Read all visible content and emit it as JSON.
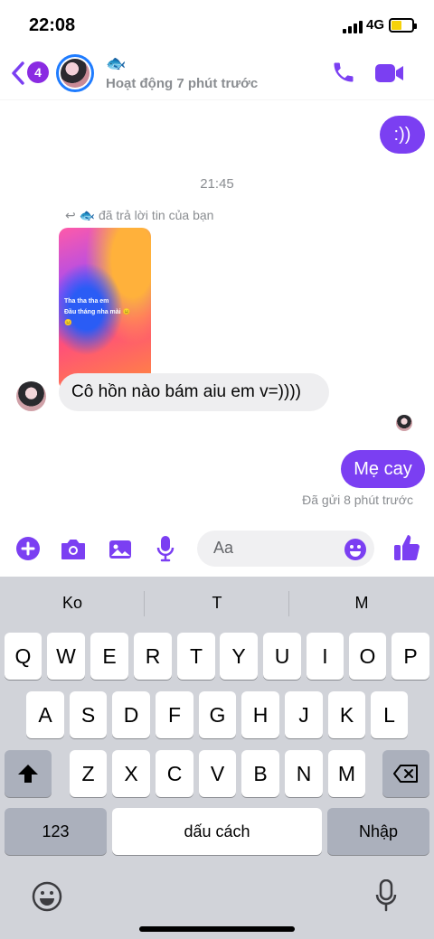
{
  "status_bar": {
    "time": "22:08",
    "network": "4G"
  },
  "header": {
    "unread_count": "4",
    "contact_emoji": "🐟",
    "activity": "Hoạt động 7 phút trước",
    "icons": [
      "back-chevron-icon",
      "phone-icon",
      "video-camera-icon"
    ]
  },
  "messages": {
    "outgoing_1": ":))",
    "timestamp": "21:45",
    "reply_note": "đã trả lời tin của bạn",
    "reply_emoji": "🐟",
    "story_caption_line1": "Tha tha tha em",
    "story_caption_line2": "Đầu tháng nha mài 😑",
    "story_caption_line3": "😑",
    "incoming_1": "Cô hồn nào bám aiu em v=))))",
    "outgoing_2": "Mẹ cay",
    "sent_status": "Đã gửi 8 phút trước"
  },
  "composer": {
    "placeholder": "Aa",
    "icons": [
      "plus-icon",
      "camera-icon",
      "image-icon",
      "microphone-icon",
      "emoji-icon",
      "thumbs-up-icon"
    ]
  },
  "keyboard": {
    "suggestions": [
      "Ko",
      "T",
      "M"
    ],
    "row1": [
      "Q",
      "W",
      "E",
      "R",
      "T",
      "Y",
      "U",
      "I",
      "O",
      "P"
    ],
    "row2": [
      "A",
      "S",
      "D",
      "F",
      "G",
      "H",
      "J",
      "K",
      "L"
    ],
    "row3": [
      "Z",
      "X",
      "C",
      "V",
      "B",
      "N",
      "M"
    ],
    "numbers_key": "123",
    "space_key": "dấu cách",
    "return_key": "Nhập"
  },
  "colors": {
    "accent": "#7b3ff2",
    "link_blue": "#1f7cff",
    "bubble_in": "#eeeef0",
    "keyboard_bg": "#d1d3d9"
  }
}
